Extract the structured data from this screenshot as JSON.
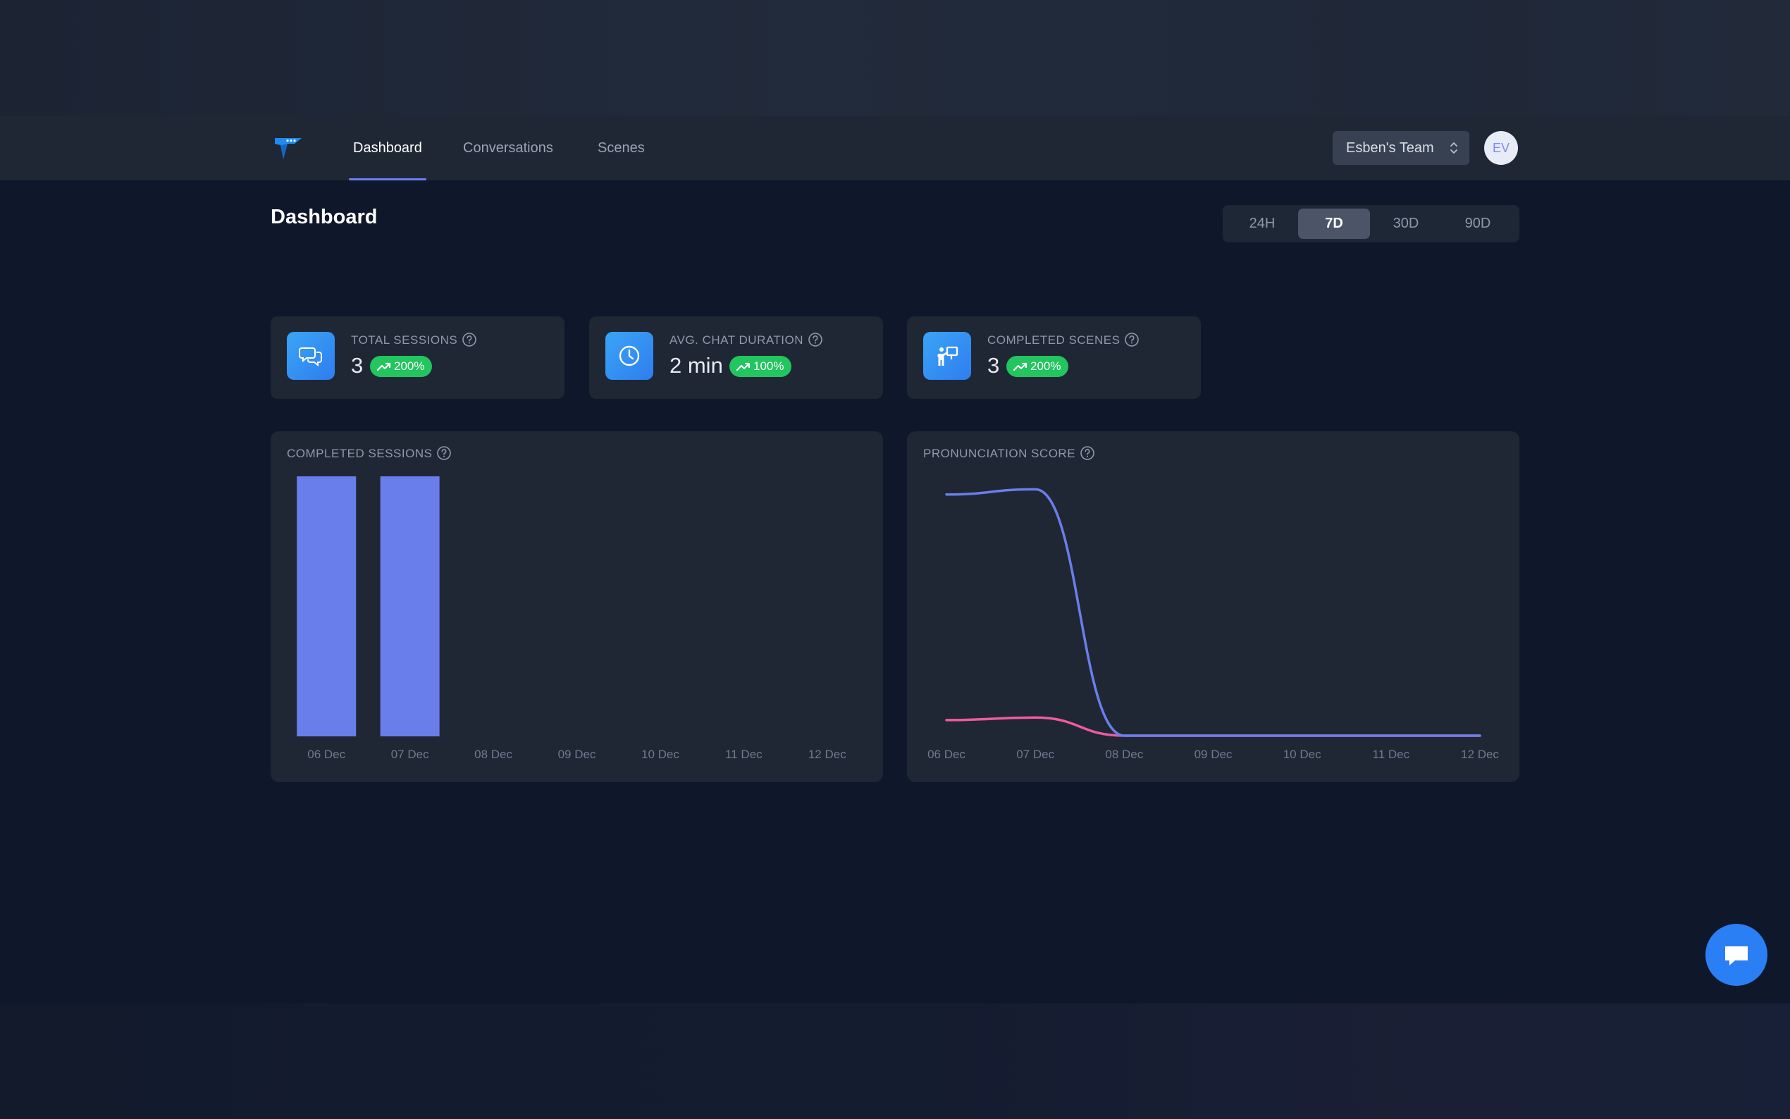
{
  "nav": {
    "tabs": [
      {
        "label": "Dashboard",
        "active": true
      },
      {
        "label": "Conversations",
        "active": false
      },
      {
        "label": "Scenes",
        "active": false
      }
    ],
    "team_select": "Esben's Team",
    "avatar_initials": "EV"
  },
  "page_title": "Dashboard",
  "time_range": {
    "options": [
      "24H",
      "7D",
      "30D",
      "90D"
    ],
    "selected": "7D"
  },
  "stats": [
    {
      "label": "TOTAL SESSIONS",
      "value": "3",
      "change": "200%",
      "icon": "chat-bubbles-icon"
    },
    {
      "label": "AVG. CHAT DURATION",
      "value": "2 min",
      "change": "100%",
      "icon": "clock-icon"
    },
    {
      "label": "COMPLETED SCENES",
      "value": "3",
      "change": "200%",
      "icon": "presenter-board-icon"
    }
  ],
  "colors": {
    "accent": "#6b7ff0",
    "bar": "#6a7eeb",
    "line_primary": "#6a7eeb",
    "line_secondary": "#f05aa0",
    "badge_green": "#22c55e",
    "icon_gradient": "#3aa5f5"
  },
  "chart_data": [
    {
      "type": "bar",
      "title": "COMPLETED SESSIONS",
      "categories": [
        "06 Dec",
        "07 Dec",
        "08 Dec",
        "09 Dec",
        "10 Dec",
        "11 Dec",
        "12 Dec"
      ],
      "values": [
        1,
        1,
        0,
        0,
        0,
        0,
        0
      ],
      "ylim": [
        0,
        1
      ],
      "grid": false
    },
    {
      "type": "line",
      "title": "PRONUNCIATION SCORE",
      "categories": [
        "06 Dec",
        "07 Dec",
        "08 Dec",
        "09 Dec",
        "10 Dec",
        "11 Dec",
        "12 Dec"
      ],
      "series": [
        {
          "values": [
            93,
            95,
            0,
            0,
            0,
            0,
            0
          ]
        },
        {
          "values": [
            6,
            7,
            0,
            0,
            0,
            0,
            0
          ]
        }
      ],
      "ylim": [
        0,
        100
      ],
      "grid": false
    }
  ]
}
